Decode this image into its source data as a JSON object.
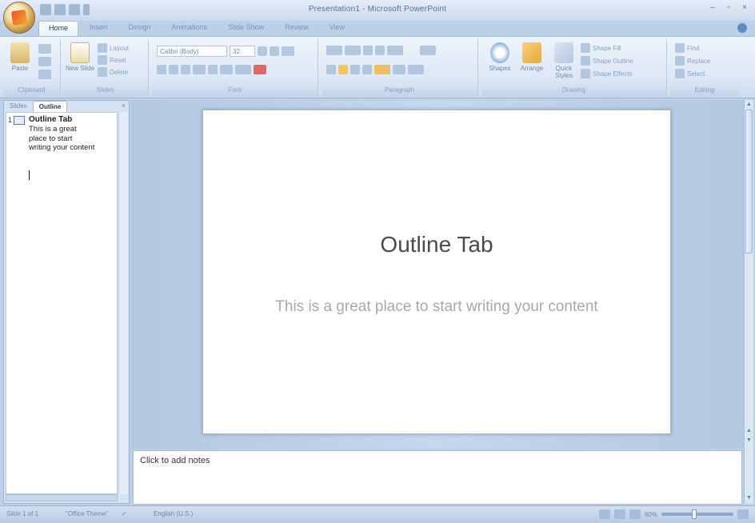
{
  "window": {
    "title": "Presentation1 - Microsoft PowerPoint",
    "minimize": "–",
    "maximize": "▫",
    "close": "×"
  },
  "ribbon": {
    "tabs": [
      "Home",
      "Insert",
      "Design",
      "Animations",
      "Slide Show",
      "Review",
      "View"
    ],
    "active_tab": "Home",
    "groups": {
      "clipboard": {
        "label": "Clipboard",
        "paste": "Paste"
      },
      "slides": {
        "label": "Slides",
        "new_slide": "New Slide",
        "layout": "Layout",
        "reset": "Reset",
        "delete": "Delete"
      },
      "font": {
        "label": "Font",
        "font_name": "Calibri (Body)",
        "font_size": "32"
      },
      "paragraph": {
        "label": "Paragraph"
      },
      "drawing": {
        "label": "Drawing",
        "shapes": "Shapes",
        "arrange": "Arrange",
        "quick_styles": "Quick Styles",
        "shape_fill": "Shape Fill",
        "shape_outline": "Shape Outline",
        "shape_effects": "Shape Effects"
      },
      "editing": {
        "label": "Editing",
        "find": "Find",
        "replace": "Replace",
        "select": "Select"
      }
    }
  },
  "left_pane": {
    "tabs": [
      "Slides",
      "Outline"
    ],
    "active_tab": "Outline",
    "close": "×",
    "outline": {
      "slide_number": "1",
      "title": "Outline Tab",
      "body": "This is a great place to start writing your content"
    }
  },
  "slide": {
    "title": "Outline Tab",
    "subtitle": "This is a great place to start writing your content"
  },
  "notes": {
    "placeholder": "Click to add notes"
  },
  "status": {
    "slide_info": "Slide 1 of 1",
    "theme": "\"Office Theme\"",
    "language": "English (U.S.)",
    "zoom": "60%"
  },
  "icons": {
    "office_button": "office-logo-icon",
    "save": "save-icon",
    "undo": "undo-icon",
    "redo": "redo-icon",
    "help": "help-icon"
  },
  "colors": {
    "ribbon_bg": "#dfe9f6",
    "workspace_bg": "#bcd0e8",
    "accent": "#1e3a5f"
  }
}
